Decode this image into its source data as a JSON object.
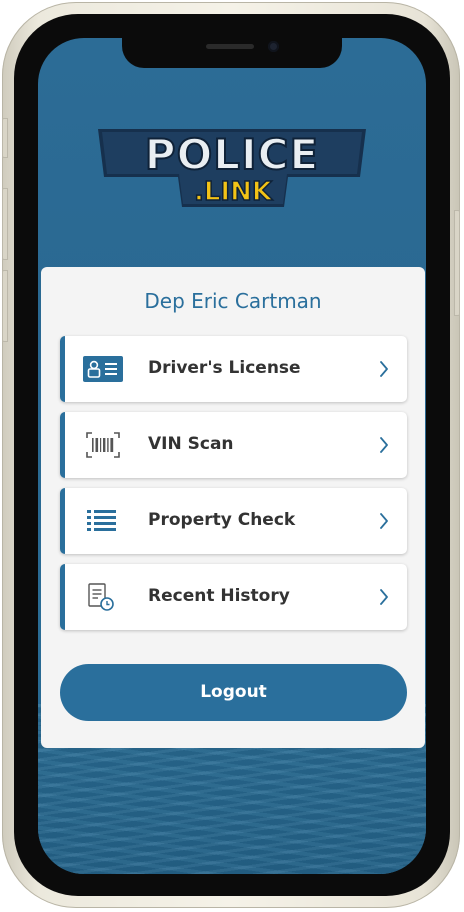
{
  "logo": {
    "line1": "POLICE",
    "line2": ".LINK"
  },
  "user": {
    "name": "Dep Eric Cartman"
  },
  "menu": [
    {
      "label": "Driver's License",
      "icon": "id-card-icon"
    },
    {
      "label": "VIN Scan",
      "icon": "barcode-icon"
    },
    {
      "label": "Property Check",
      "icon": "checklist-icon"
    },
    {
      "label": "Recent History",
      "icon": "history-document-icon"
    }
  ],
  "logout": {
    "label": "Logout"
  },
  "colors": {
    "accent": "#2a6f9c",
    "background": "#2a6891",
    "card": "#f4f4f4",
    "logo_yellow": "#f3c316"
  }
}
